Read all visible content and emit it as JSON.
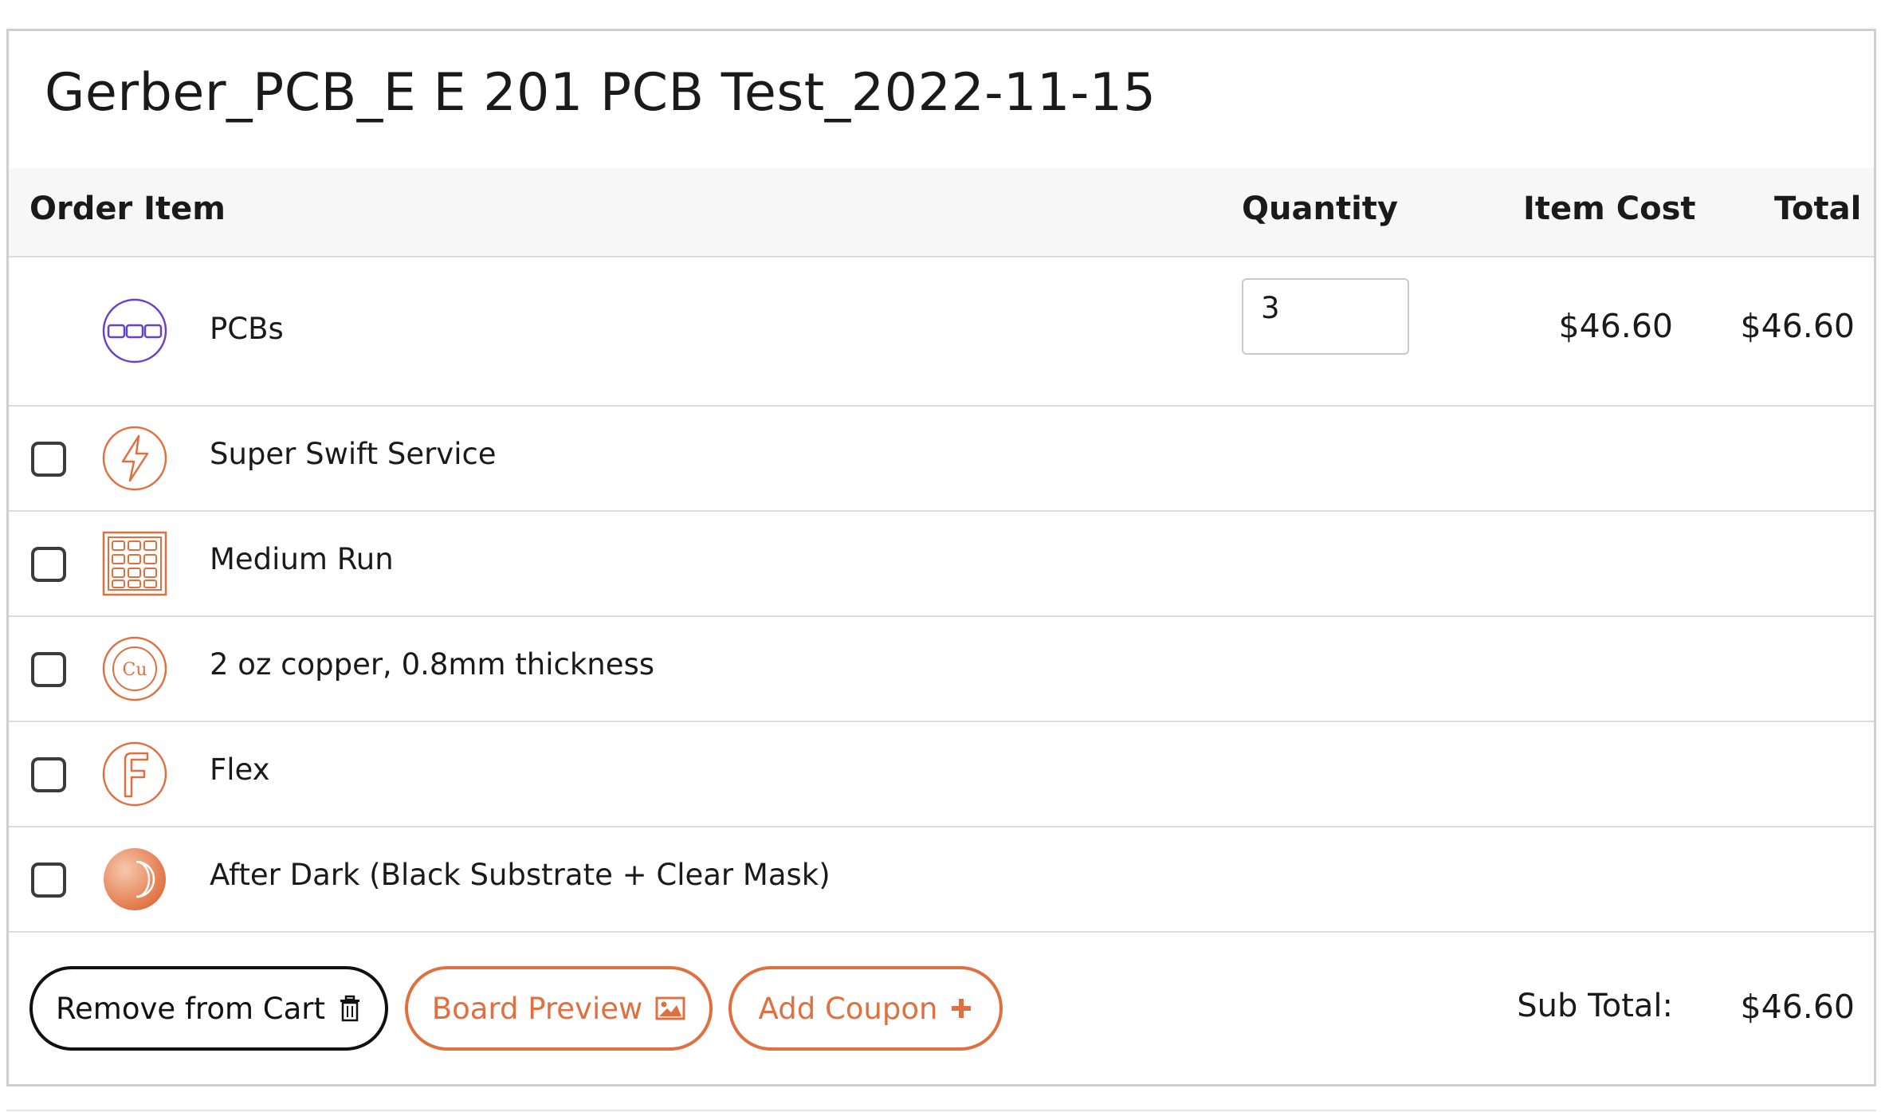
{
  "cart": {
    "title": "Gerber_PCB_E E 201 PCB Test_2022-11-15",
    "headers": {
      "order_item": "Order Item",
      "quantity": "Quantity",
      "item_cost": "Item Cost",
      "total": "Total"
    },
    "main_item": {
      "label": "PCBs",
      "icon": "pcb-icon",
      "quantity": "3",
      "item_cost": "$46.60",
      "total": "$46.60"
    },
    "options": [
      {
        "label": "Super Swift Service",
        "icon": "lightning-icon",
        "checked": false
      },
      {
        "label": "Medium Run",
        "icon": "grid-panel-icon",
        "checked": false
      },
      {
        "label": "2 oz copper, 0.8mm thickness",
        "icon": "copper-icon",
        "icon_text": "Cu",
        "checked": false
      },
      {
        "label": "Flex",
        "icon": "flex-icon",
        "checked": false
      },
      {
        "label": "After Dark (Black Substrate + Clear Mask)",
        "icon": "moon-icon",
        "checked": false
      }
    ],
    "buttons": {
      "remove": "Remove from Cart",
      "preview": "Board Preview",
      "coupon": "Add Coupon"
    },
    "subtotal_label": "Sub Total:",
    "subtotal_value": "$46.60",
    "colors": {
      "accent": "#e0703f",
      "purple": "#6a3fc9",
      "border": "#cfcfcf",
      "header_bg": "#f7f7f7"
    }
  }
}
